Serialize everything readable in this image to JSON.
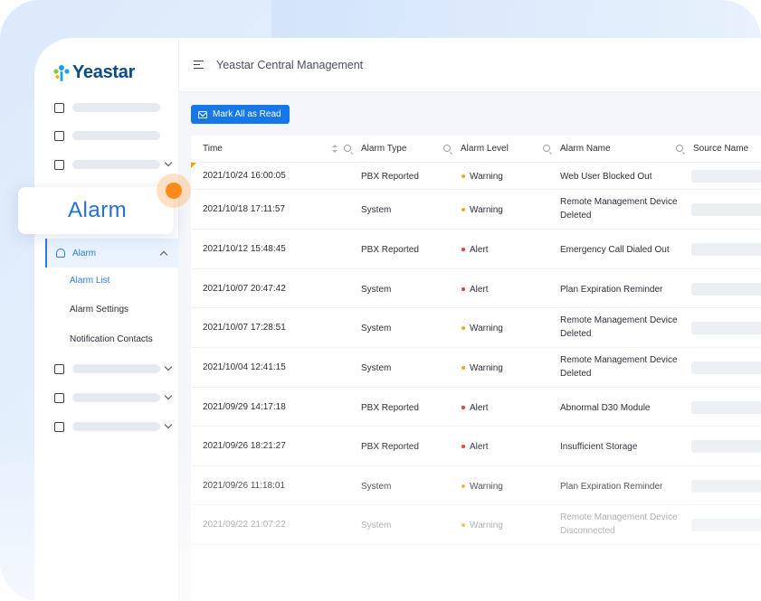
{
  "brand": {
    "name": "Yeastar"
  },
  "topbar": {
    "title": "Yeastar Central Management"
  },
  "toolbar": {
    "mark_all_label": "Mark All as Read"
  },
  "highlight": {
    "label": "Alarm"
  },
  "sidebar": {
    "alarm_menu": {
      "label": "Alarm"
    },
    "alarm_sub": [
      "Alarm List",
      "Alarm Settings",
      "Notification Contacts"
    ]
  },
  "table": {
    "headers": {
      "time": "Time",
      "alarm_type": "Alarm Type",
      "alarm_level": "Alarm Level",
      "alarm_name": "Alarm Name",
      "source_name": "Source Name"
    },
    "rows": [
      {
        "time": "2021/10/24 16:00:05",
        "type": "PBX Reported",
        "level": "Warning",
        "name1": "Web User Blocked Out",
        "name2": ""
      },
      {
        "time": "2021/10/18 17:11:57",
        "type": "System",
        "level": "Warning",
        "name1": "Remote Management Device",
        "name2": "Deleted"
      },
      {
        "time": "2021/10/12 15:48:45",
        "type": "PBX Reported",
        "level": "Alert",
        "name1": "Emergency Call Dialed Out",
        "name2": ""
      },
      {
        "time": "2021/10/07 20:47:42",
        "type": "System",
        "level": "Alert",
        "name1": "Plan Expiration Reminder",
        "name2": ""
      },
      {
        "time": "2021/10/07 17:28:51",
        "type": "System",
        "level": "Warning",
        "name1": "Remote Management Device",
        "name2": "Deleted"
      },
      {
        "time": "2021/10/04 12:41:15",
        "type": "System",
        "level": "Warning",
        "name1": "Remote Management Device",
        "name2": "Deleted"
      },
      {
        "time": "2021/09/29 14:17:18",
        "type": "PBX Reported",
        "level": "Alert",
        "name1": "Abnormal D30 Module",
        "name2": ""
      },
      {
        "time": "2021/09/26 18:21:27",
        "type": "PBX Reported",
        "level": "Alert",
        "name1": "Insufficient Storage",
        "name2": ""
      },
      {
        "time": "2021/09/26 11:18:01",
        "type": "System",
        "level": "Warning",
        "name1": "Plan Expiration Reminder",
        "name2": ""
      },
      {
        "time": "2021/09/22 21:07:22",
        "type": "System",
        "level": "Warning",
        "name1": "Remote Management Device",
        "name2": "Disconnected"
      }
    ]
  },
  "colors": {
    "accent": "#1677e8",
    "warning": "#f5a623",
    "alert": "#e8393b",
    "highlight_dot": "#ff8a1a"
  }
}
